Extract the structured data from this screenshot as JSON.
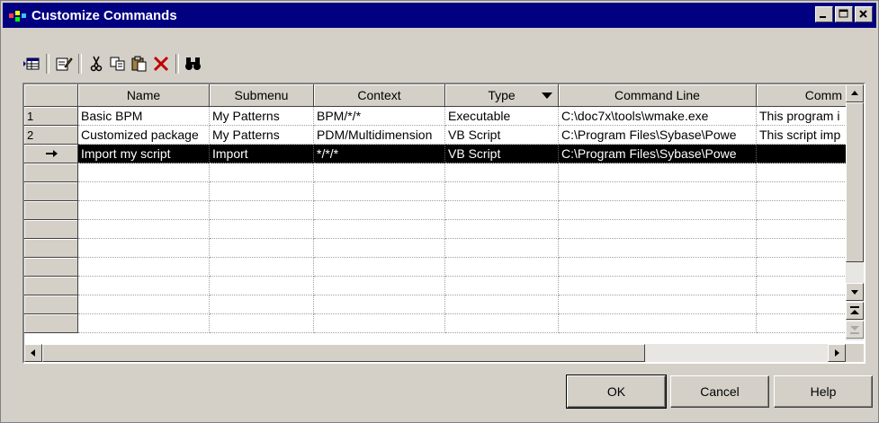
{
  "window": {
    "title": "Customize Commands"
  },
  "toolbar": {
    "tools": [
      {
        "name": "properties-icon"
      },
      {
        "name": "edit-icon"
      },
      {
        "name": "cut-icon"
      },
      {
        "name": "copy-icon"
      },
      {
        "name": "paste-icon"
      },
      {
        "name": "delete-icon"
      },
      {
        "name": "find-icon"
      }
    ]
  },
  "grid": {
    "columns": [
      "Name",
      "Submenu",
      "Context",
      "Type",
      "Command Line",
      "Comm"
    ],
    "rows": [
      {
        "num": "1",
        "name": "Basic BPM",
        "submenu": "My Patterns",
        "context": "BPM/*/*",
        "type": "Executable",
        "command_line": "C:\\doc7x\\tools\\wmake.exe",
        "comment": "This program i"
      },
      {
        "num": "2",
        "name": "Customized package",
        "submenu": "My Patterns",
        "context": "PDM/Multidimension",
        "type": "VB Script",
        "command_line": "C:\\Program Files\\Sybase\\Powe",
        "comment": "This script imp"
      },
      {
        "num": "",
        "name": "Import my script",
        "submenu": "Import",
        "context": "*/*/*",
        "type": "VB Script",
        "command_line": "C:\\Program Files\\Sybase\\Powe",
        "comment": ""
      }
    ],
    "empty_rows": 9
  },
  "buttons": {
    "ok": "OK",
    "cancel": "Cancel",
    "help": "Help"
  },
  "colors": {
    "title_bar": "#000080",
    "selection": "#000000",
    "face": "#d4d0c8"
  }
}
